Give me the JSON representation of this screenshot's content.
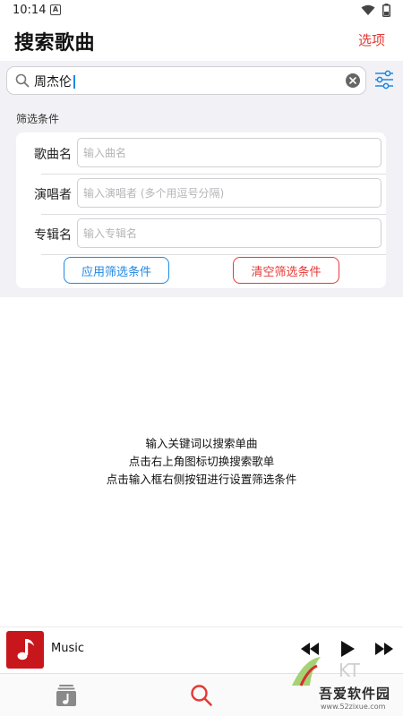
{
  "status_bar": {
    "time": "10:14",
    "notification_badge": "A"
  },
  "header": {
    "title": "搜索歌曲",
    "options_label": "选项"
  },
  "search": {
    "value": "周杰伦",
    "placeholder": ""
  },
  "filters": {
    "heading": "筛选条件",
    "fields": [
      {
        "label": "歌曲名",
        "placeholder": "输入曲名",
        "value": ""
      },
      {
        "label": "演唱者",
        "placeholder": "输入演唱者 (多个用逗号分隔)",
        "value": ""
      },
      {
        "label": "专辑名",
        "placeholder": "输入专辑名",
        "value": ""
      }
    ],
    "apply_label": "应用筛选条件",
    "clear_label": "清空筛选条件"
  },
  "hints": [
    "输入关键词以搜索单曲",
    "点击右上角图标切换搜索歌单",
    "点击输入框右侧按钮进行设置筛选条件"
  ],
  "player": {
    "track_title": "Music"
  },
  "tabs": [
    {
      "name": "library",
      "icon": "music-library-icon",
      "active": false
    },
    {
      "name": "search",
      "icon": "search-icon",
      "active": true
    }
  ],
  "watermark": {
    "text": "吾爱软件园",
    "url": "www.52zixue.com"
  },
  "colors": {
    "accent_red": "#e53935",
    "accent_blue": "#1e88e5",
    "album_red": "#c8161d",
    "background_gray": "#f2f2f6"
  }
}
